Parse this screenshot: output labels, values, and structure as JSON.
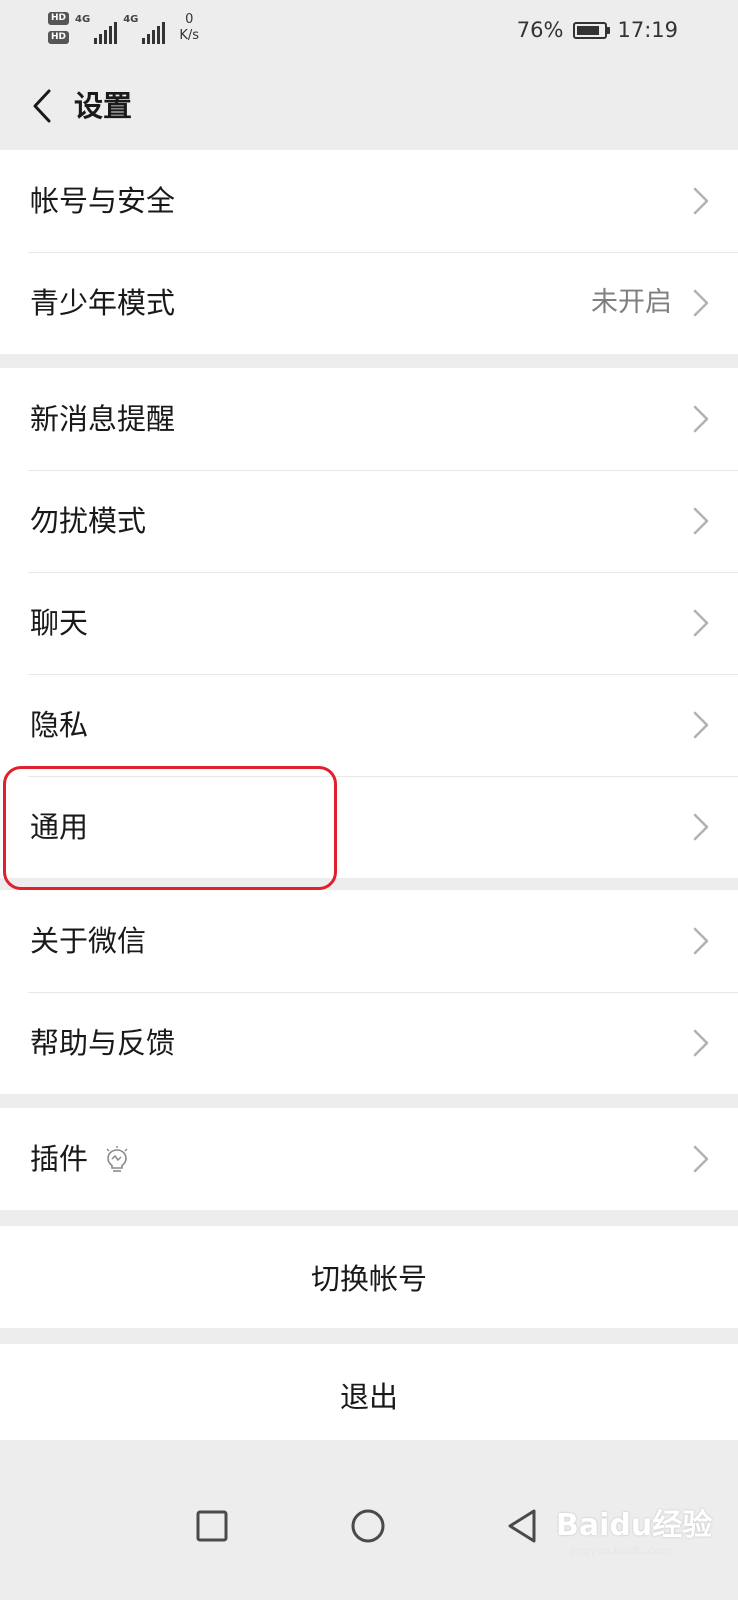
{
  "status_bar": {
    "hd1": "HD",
    "hd2": "HD",
    "net1": "4G",
    "net2": "4G",
    "speed_value": "0",
    "speed_unit": "K/s",
    "battery": "76%",
    "time": "17:19"
  },
  "nav": {
    "title": "设置"
  },
  "groups": [
    [
      {
        "label": "帐号与安全",
        "value": ""
      },
      {
        "label": "青少年模式",
        "value": "未开启"
      }
    ],
    [
      {
        "label": "新消息提醒",
        "value": ""
      },
      {
        "label": "勿扰模式",
        "value": ""
      },
      {
        "label": "聊天",
        "value": ""
      },
      {
        "label": "隐私",
        "value": ""
      },
      {
        "label": "通用",
        "value": ""
      }
    ],
    [
      {
        "label": "关于微信",
        "value": ""
      },
      {
        "label": "帮助与反馈",
        "value": ""
      }
    ],
    [
      {
        "label": "插件",
        "value": ""
      }
    ]
  ],
  "actions": {
    "switch_account": "切换帐号",
    "logout": "退出"
  },
  "watermark": {
    "brand": "Baidu经验",
    "url": "jingyan.baidu.com"
  },
  "colors": {
    "background": "#ededed",
    "highlight": "#e0202c",
    "chevron": "#b2b2b2",
    "secondary_text": "#7f7f7f"
  },
  "icons": {
    "back": "chevron-left-icon",
    "row_arrow": "chevron-right-icon",
    "plugin_badge": "lightbulb-icon"
  }
}
